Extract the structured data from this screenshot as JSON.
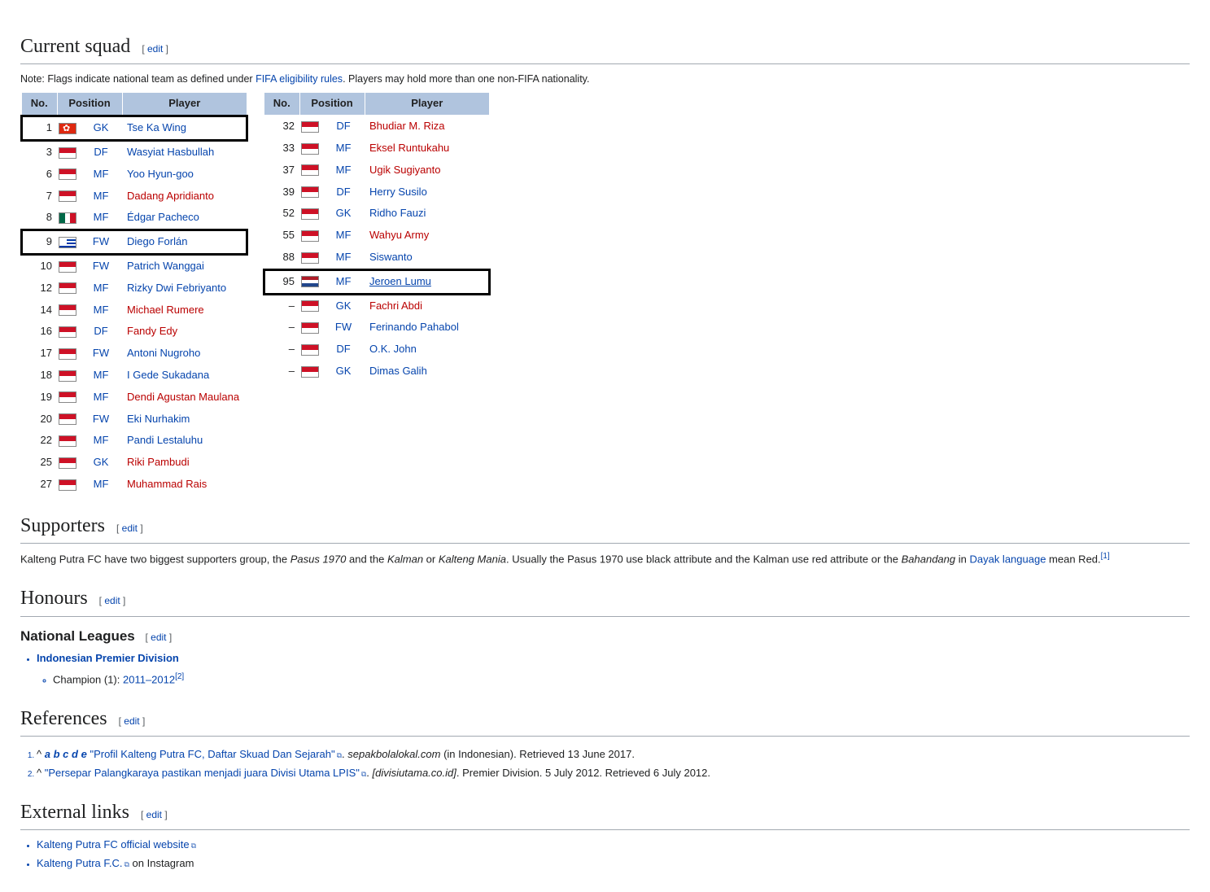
{
  "sections": {
    "squad": {
      "title": "Current squad",
      "edit": "edit"
    },
    "supporters": {
      "title": "Supporters",
      "edit": "edit"
    },
    "honours": {
      "title": "Honours",
      "edit": "edit"
    },
    "natleagues": {
      "title": "National Leagues",
      "edit": "edit"
    },
    "references": {
      "title": "References",
      "edit": "edit"
    },
    "extlinks": {
      "title": "External links",
      "edit": "edit"
    }
  },
  "note_prefix": "Note: Flags indicate national team as defined under ",
  "note_link": "FIFA eligibility rules",
  "note_suffix": ". Players may hold more than one non-FIFA nationality.",
  "headers": {
    "no": "No.",
    "pos": "Position",
    "player": "Player"
  },
  "squad_left": [
    {
      "no": "1",
      "flag": "hk",
      "pos": "GK",
      "name": "Tse Ka Wing",
      "red": false,
      "hl": true
    },
    {
      "no": "3",
      "flag": "id",
      "pos": "DF",
      "name": "Wasyiat Hasbullah",
      "red": false
    },
    {
      "no": "6",
      "flag": "id",
      "pos": "MF",
      "name": "Yoo Hyun-goo",
      "red": false
    },
    {
      "no": "7",
      "flag": "id",
      "pos": "MF",
      "name": "Dadang Apridianto",
      "red": true
    },
    {
      "no": "8",
      "flag": "mx",
      "pos": "MF",
      "name": "Édgar Pacheco",
      "red": false
    },
    {
      "no": "9",
      "flag": "uy",
      "pos": "FW",
      "name": "Diego Forlán",
      "red": false,
      "hl": true
    },
    {
      "no": "10",
      "flag": "id",
      "pos": "FW",
      "name": "Patrich Wanggai",
      "red": false
    },
    {
      "no": "12",
      "flag": "id",
      "pos": "MF",
      "name": "Rizky Dwi Febriyanto",
      "red": false
    },
    {
      "no": "14",
      "flag": "id",
      "pos": "MF",
      "name": "Michael Rumere",
      "red": true
    },
    {
      "no": "16",
      "flag": "id",
      "pos": "DF",
      "name": "Fandy Edy",
      "red": true
    },
    {
      "no": "17",
      "flag": "id",
      "pos": "FW",
      "name": "Antoni Nugroho",
      "red": false
    },
    {
      "no": "18",
      "flag": "id",
      "pos": "MF",
      "name": "I Gede Sukadana",
      "red": false
    },
    {
      "no": "19",
      "flag": "id",
      "pos": "MF",
      "name": "Dendi Agustan Maulana",
      "red": true
    },
    {
      "no": "20",
      "flag": "id",
      "pos": "FW",
      "name": "Eki Nurhakim",
      "red": false
    },
    {
      "no": "22",
      "flag": "id",
      "pos": "MF",
      "name": "Pandi Lestaluhu",
      "red": false
    },
    {
      "no": "25",
      "flag": "id",
      "pos": "GK",
      "name": "Riki Pambudi",
      "red": true
    },
    {
      "no": "27",
      "flag": "id",
      "pos": "MF",
      "name": "Muhammad Rais",
      "red": true
    }
  ],
  "squad_right": [
    {
      "no": "32",
      "flag": "id",
      "pos": "DF",
      "name": "Bhudiar M. Riza",
      "red": true
    },
    {
      "no": "33",
      "flag": "id",
      "pos": "MF",
      "name": "Eksel Runtukahu",
      "red": true
    },
    {
      "no": "37",
      "flag": "id",
      "pos": "MF",
      "name": "Ugik Sugiyanto",
      "red": true
    },
    {
      "no": "39",
      "flag": "id",
      "pos": "DF",
      "name": "Herry Susilo",
      "red": false
    },
    {
      "no": "52",
      "flag": "id",
      "pos": "GK",
      "name": "Ridho Fauzi",
      "red": false
    },
    {
      "no": "55",
      "flag": "id",
      "pos": "MF",
      "name": "Wahyu Army",
      "red": true
    },
    {
      "no": "88",
      "flag": "id",
      "pos": "MF",
      "name": "Siswanto",
      "red": false
    },
    {
      "no": "95",
      "flag": "nl",
      "pos": "MF",
      "name": "Jeroen Lumu",
      "red": false,
      "hl": true,
      "underline": true
    },
    {
      "no": "–",
      "flag": "id",
      "pos": "GK",
      "name": "Fachri Abdi",
      "red": true
    },
    {
      "no": "–",
      "flag": "id",
      "pos": "FW",
      "name": "Ferinando Pahabol",
      "red": false
    },
    {
      "no": "–",
      "flag": "id",
      "pos": "DF",
      "name": "O.K. John",
      "red": false
    },
    {
      "no": "–",
      "flag": "id",
      "pos": "GK",
      "name": "Dimas Galih",
      "red": false
    }
  ],
  "supporters_text": {
    "p1": "Kalteng Putra FC have two biggest supporters group, the ",
    "i1": "Pasus 1970",
    "p2": " and the ",
    "i2": "Kalman",
    "p3": " or ",
    "i3": "Kalteng Mania",
    "p4": ". Usually the Pasus 1970 use black attribute and the Kalman use red attribute or the ",
    "i4": "Bahandang",
    "p5": " in ",
    "link": "Dayak language",
    "p6": " mean Red.",
    "ref": "[1]"
  },
  "honours": {
    "league_link": "Indonesian Premier Division",
    "champion_prefix": "Champion (1): ",
    "champion_link": "2011–2012",
    "champion_ref": "[2]"
  },
  "references": [
    {
      "markers": "a b c d e",
      "title": "\"Profil Kalteng Putra FC, Daftar Skuad Dan Sejarah\"",
      "site": "sepakbolalokal.com",
      "lang": " (in Indonesian)",
      "retrieved": ". Retrieved 13 June 2017."
    },
    {
      "markers": "",
      "title": "\"Persepar Palangkaraya pastikan menjadi juara Divisi Utama LPIS\"",
      "site": "[divisiutama.co.id]",
      "lang": ". Premier Division. 5 July 2012",
      "retrieved": ". Retrieved 6 July 2012."
    }
  ],
  "extlinks": [
    {
      "text": "Kalteng Putra FC official website",
      "suffix": ""
    },
    {
      "text": "Kalteng Putra F.C.",
      "suffix": " on Instagram"
    }
  ]
}
